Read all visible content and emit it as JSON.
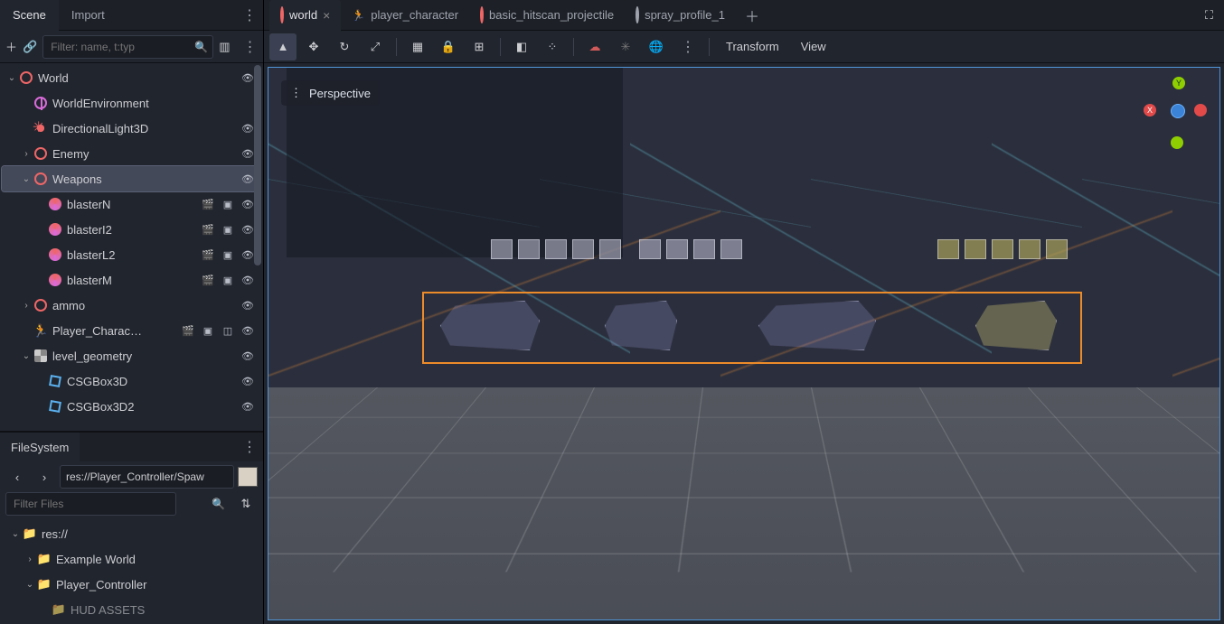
{
  "panels": {
    "scene_tab": "Scene",
    "import_tab": "Import",
    "filesystem_tab": "FileSystem"
  },
  "scene_filter_placeholder": "Filter: name, t:typ",
  "tree": {
    "world": "World",
    "worldenv": "WorldEnvironment",
    "dirlight": "DirectionalLight3D",
    "enemy": "Enemy",
    "weapons": "Weapons",
    "blasterN": "blasterN",
    "blasterI2": "blasterI2",
    "blasterL2": "blasterL2",
    "blasterM": "blasterM",
    "ammo": "ammo",
    "player_char": "Player_Charac…",
    "level_geo": "level_geometry",
    "csgbox1": "CSGBox3D",
    "csgbox2": "CSGBox3D2"
  },
  "fs": {
    "path": "res://Player_Controller/Spaw",
    "filter_placeholder": "Filter Files",
    "root": "res://",
    "example_world": "Example World",
    "player_controller": "Player_Controller",
    "hud_assets": "HUD ASSETS"
  },
  "scene_tabs": {
    "world": "world",
    "player_character": "player_character",
    "basic_hitscan": "basic_hitscan_projectile",
    "spray_profile": "spray_profile_1"
  },
  "vp": {
    "perspective": "Perspective",
    "transform": "Transform",
    "view": "View"
  },
  "gizmo": {
    "y": "Y",
    "x": "X"
  }
}
